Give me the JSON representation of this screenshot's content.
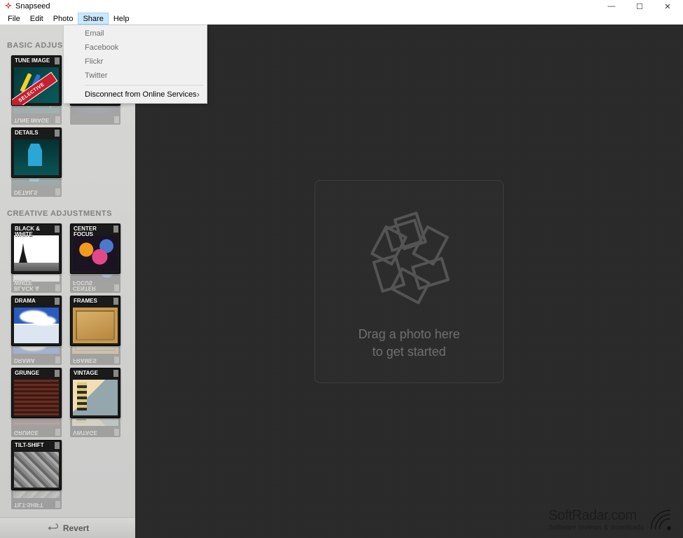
{
  "app": {
    "title": "Snapseed"
  },
  "window_controls": {
    "minimize": "—",
    "maximize": "☐",
    "close": "✕"
  },
  "menubar": {
    "items": [
      {
        "label": "File"
      },
      {
        "label": "Edit"
      },
      {
        "label": "Photo"
      },
      {
        "label": "Share",
        "active": true
      },
      {
        "label": "Help"
      }
    ]
  },
  "share_menu": {
    "items": [
      {
        "label": "Email",
        "enabled": false
      },
      {
        "label": "Facebook",
        "enabled": false
      },
      {
        "label": "Flickr",
        "enabled": false
      },
      {
        "label": "Twitter",
        "enabled": false
      }
    ],
    "disconnect": "Disconnect from Online Services"
  },
  "sidebar": {
    "sections": [
      {
        "header": "BASIC ADJUSTMENTS",
        "rows": [
          [
            {
              "label": "TUNE IMAGE",
              "thumb": "tune",
              "ribbon": "SELECTIVE"
            },
            {
              "label": "",
              "thumb": "crop"
            }
          ],
          [
            {
              "label": "DETAILS",
              "thumb": "details"
            }
          ]
        ]
      },
      {
        "header": "CREATIVE ADJUSTMENTS",
        "rows": [
          [
            {
              "label": "BLACK & WHITE",
              "thumb": "bw"
            },
            {
              "label": "CENTER FOCUS",
              "thumb": "center"
            }
          ],
          [
            {
              "label": "DRAMA",
              "thumb": "drama"
            },
            {
              "label": "FRAMES",
              "thumb": "frames"
            }
          ],
          [
            {
              "label": "GRUNGE",
              "thumb": "grunge"
            },
            {
              "label": "VINTAGE",
              "thumb": "vintage"
            }
          ],
          [
            {
              "label": "TILT-SHIFT",
              "thumb": "tilt"
            }
          ]
        ]
      }
    ],
    "revert": "Revert"
  },
  "canvas": {
    "drop_line1": "Drag a photo here",
    "drop_line2": "to get started"
  },
  "watermark": {
    "title": "SoftRadar.com",
    "subtitle": "Software reviews & downloads"
  }
}
